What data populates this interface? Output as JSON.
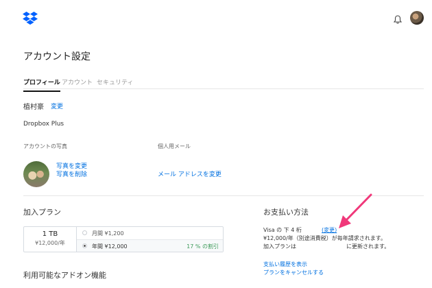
{
  "header": {
    "brand_icon": "dropbox-logo-icon",
    "bell_icon": "bell-icon",
    "accent_color": "#0061ff"
  },
  "page": {
    "title": "アカウント設定"
  },
  "tabs": [
    {
      "label": "プロフィール",
      "active": true
    },
    {
      "label": "アカウント",
      "active": false
    },
    {
      "label": "セキュリティ",
      "active": false
    }
  ],
  "profile": {
    "name": "植村豪",
    "change_name_link": "変更",
    "plan_name": "Dropbox Plus",
    "photo_label": "アカウントの写真",
    "email_label": "個人用メール",
    "change_photo_link": "写真を変更",
    "delete_photo_link": "写真を削除",
    "change_email_link": "メール アドレスを変更"
  },
  "plan": {
    "section_title": "加入プラン",
    "capacity": "1 TB",
    "price_per_year": "¥12,000/年",
    "options": [
      {
        "label": "月間 ¥1,200",
        "selected": false,
        "badge": ""
      },
      {
        "label": "年間 ¥12,000",
        "selected": true,
        "badge": "17 % の割引"
      }
    ],
    "badge_color": "#3d9b5a"
  },
  "payment": {
    "section_title": "お支払い方法",
    "card_line": "Visa の 下 4 桁",
    "change_link": "(変更)",
    "billing_line": "¥12,000/年（別途消費税）が毎年請求されます。",
    "renew_prefix": "加入プランは",
    "renew_suffix": "に更新されます。",
    "history_link": "支払い履歴を表示",
    "cancel_link": "プランをキャンセルする"
  },
  "addons": {
    "section_title": "利用可能なアドオン機能"
  },
  "annotation": {
    "arrow_color": "#f0387a"
  }
}
